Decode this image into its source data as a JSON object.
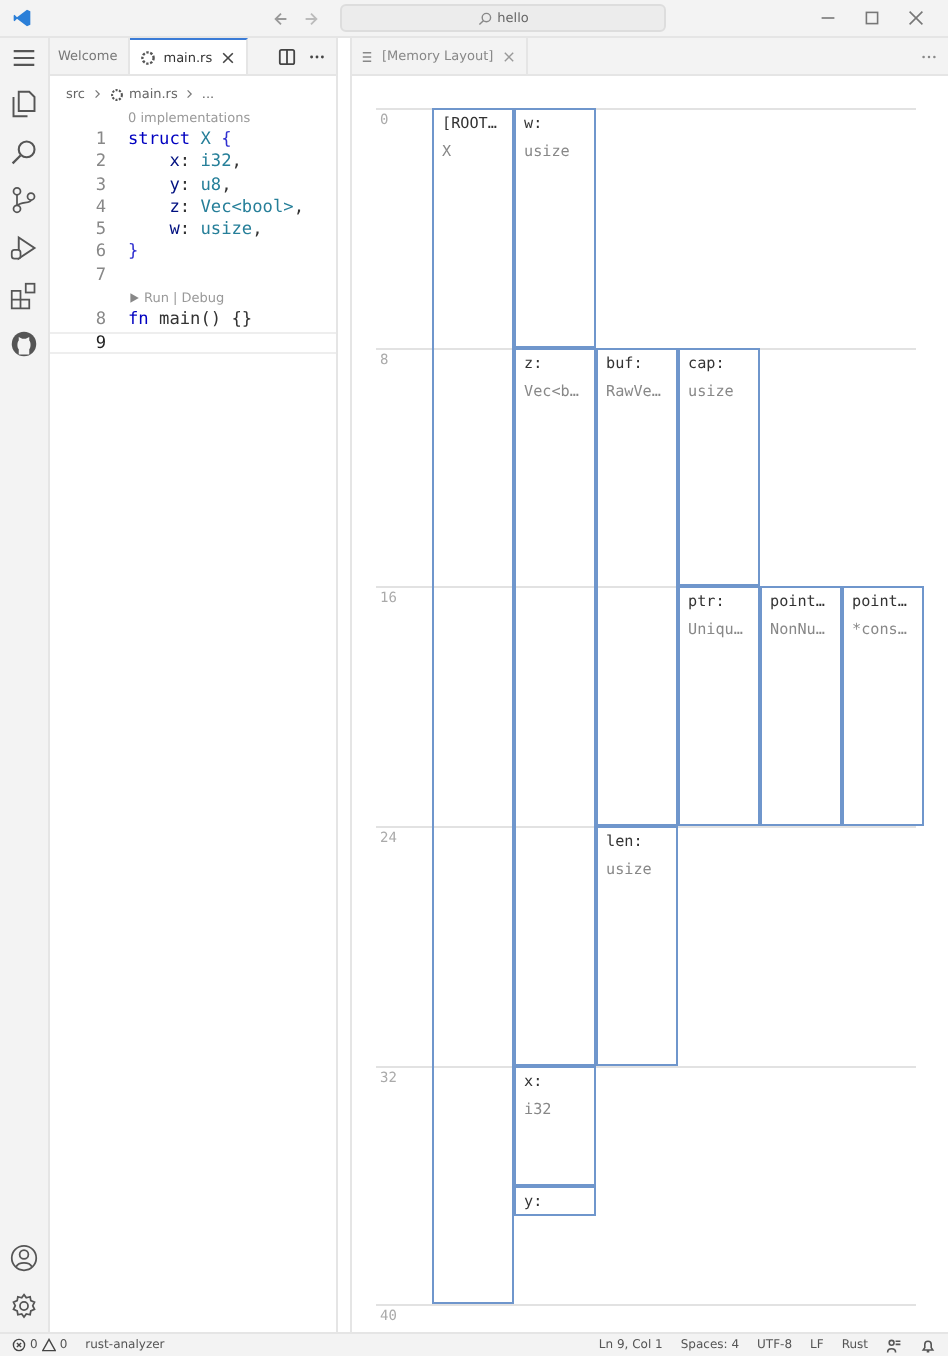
{
  "title_bar": {
    "search": {
      "value": "hello"
    }
  },
  "editor_tabs": [
    {
      "label": "Welcome",
      "selected": false
    },
    {
      "label": "main.rs",
      "selected": true
    }
  ],
  "breadcrumb": [
    "src",
    "main.rs",
    "..."
  ],
  "code": [
    {
      "codelens": "0 implementations"
    },
    {
      "number": "1",
      "tokens": [
        {
          "kind": "keyword",
          "text": "struct"
        },
        {
          "kind": "type",
          "text": " X"
        },
        {
          "kind": "brace",
          "text": " {"
        }
      ]
    },
    {
      "number": "2",
      "tokens": [
        {
          "kind": "field",
          "text": "    x"
        },
        {
          "kind": "plain",
          "text": ": "
        },
        {
          "kind": "type",
          "text": "i32"
        },
        {
          "kind": "plain",
          "text": ","
        }
      ]
    },
    {
      "number": "3",
      "tokens": [
        {
          "kind": "field",
          "text": "    y"
        },
        {
          "kind": "plain",
          "text": ": "
        },
        {
          "kind": "type",
          "text": "u8"
        },
        {
          "kind": "plain",
          "text": ","
        }
      ]
    },
    {
      "number": "4",
      "tokens": [
        {
          "kind": "field",
          "text": "    z"
        },
        {
          "kind": "plain",
          "text": ": "
        },
        {
          "kind": "type",
          "text": "Vec<bool>"
        },
        {
          "kind": "plain",
          "text": ","
        }
      ]
    },
    {
      "number": "5",
      "tokens": [
        {
          "kind": "field",
          "text": "    w"
        },
        {
          "kind": "plain",
          "text": ": "
        },
        {
          "kind": "type",
          "text": "usize"
        },
        {
          "kind": "plain",
          "text": ","
        }
      ]
    },
    {
      "number": "6",
      "tokens": [
        {
          "kind": "brace",
          "text": "}"
        }
      ]
    },
    {
      "number": "7"
    },
    {
      "codelens": "Run | Debug",
      "runnable": true
    },
    {
      "number": "8",
      "tokens": [
        {
          "kind": "keyword",
          "text": "fn"
        },
        {
          "kind": "function",
          "text": " main"
        },
        {
          "kind": "plain",
          "text": "() {}"
        }
      ]
    },
    {
      "number": "9",
      "current": true
    }
  ],
  "layout_tab": {
    "label": "[Memory Layout]",
    "selected": true
  },
  "ruler": [
    "0",
    "8",
    "16",
    "24",
    "32",
    "40"
  ],
  "layout": {
    "name": "[ROOT…",
    "type": "X",
    "children": [
      {
        "name": "w:",
        "type": "usize"
      },
      {
        "name": "z:",
        "type": "Vec<b…",
        "children": [
          {
            "name": "buf:",
            "type": "RawVe…",
            "children": [
              {
                "name": "cap:",
                "type": "usize"
              },
              {
                "name": "ptr:",
                "type": "Uniqu…",
                "children": [
                  {
                    "name": "point…",
                    "type": "NonNu…",
                    "children": [
                      {
                        "name": "point…",
                        "type": "*cons…"
                      }
                    ]
                  }
                ]
              }
            ]
          },
          {
            "name": "len:",
            "type": "usize"
          }
        ]
      },
      {
        "name": "x:",
        "type": "i32"
      },
      {
        "name": "y:"
      }
    ]
  },
  "status_bar": {
    "errors": "0",
    "warnings": "0",
    "left": [
      "rust-analyzer"
    ],
    "right": [
      "Ln 9, Col 1",
      "Spaces: 4",
      "UTF-8",
      "LF",
      "Rust"
    ]
  }
}
